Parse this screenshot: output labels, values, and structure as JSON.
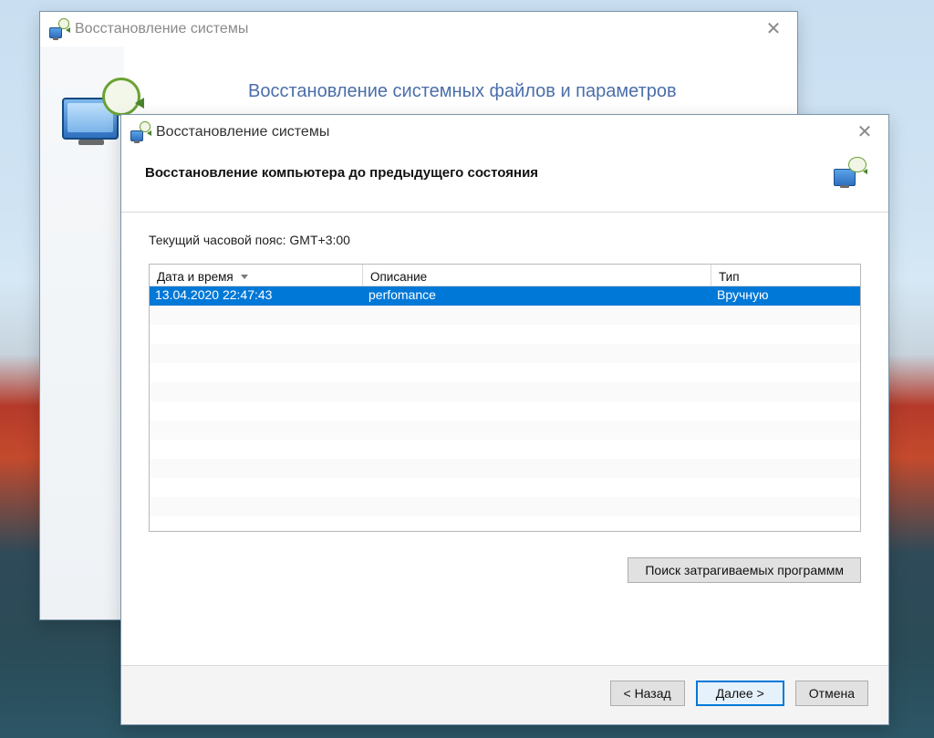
{
  "back_window": {
    "title": "Восстановление системы",
    "heading": "Восстановление системных файлов и параметров"
  },
  "front_window": {
    "title": "Восстановление системы",
    "heading": "Восстановление компьютера до предыдущего состояния",
    "timezone_label": "Текущий часовой пояс: GMT+3:00",
    "columns": {
      "datetime": "Дата и время",
      "description": "Описание",
      "type": "Тип"
    },
    "rows": [
      {
        "datetime": "13.04.2020 22:47:43",
        "description": "perfomance",
        "type": "Вручную"
      }
    ],
    "scan_button": "Поиск затрагиваемых программм",
    "buttons": {
      "back": "< Назад",
      "next": "Далее >",
      "cancel": "Отмена"
    }
  }
}
